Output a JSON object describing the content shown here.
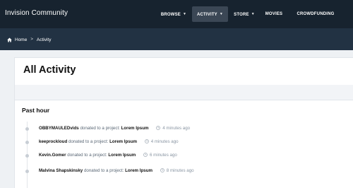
{
  "header": {
    "brand": "Invision Community",
    "nav": [
      {
        "label": "BROWSE",
        "caret": true
      },
      {
        "label": "ACTIVITY",
        "caret": true
      },
      {
        "label": "STORE",
        "caret": true
      },
      {
        "label": "MOVIES",
        "caret": false
      },
      {
        "label": "CROWDFUNDING",
        "caret": false
      }
    ]
  },
  "breadcrumb": {
    "home": "Home",
    "separator": ">",
    "current": "Activity"
  },
  "page": {
    "title": "All Activity"
  },
  "feed": {
    "section_title": "Past hour",
    "items": [
      {
        "user": "OBBYMAULEDvids",
        "action": "donated to a project:",
        "project": "Lorem Ipsum",
        "time": "4 minutes ago"
      },
      {
        "user": "keeprockloud",
        "action": "donated to a project:",
        "project": "Lorem Ipsum",
        "time": "4 minutes ago"
      },
      {
        "user": "Kevin.Gomer",
        "action": "donated to a project:",
        "project": "Lorem Ipsum",
        "time": "6 minutes ago"
      },
      {
        "user": "Malvina Shapskinsky",
        "action": "donated to a project:",
        "project": "Lorem Ipsum",
        "time": "8 minutes ago"
      }
    ]
  },
  "colors": {
    "topbar": "#17232f",
    "crumbbar": "#223243",
    "active_nav": "#3b4755"
  }
}
